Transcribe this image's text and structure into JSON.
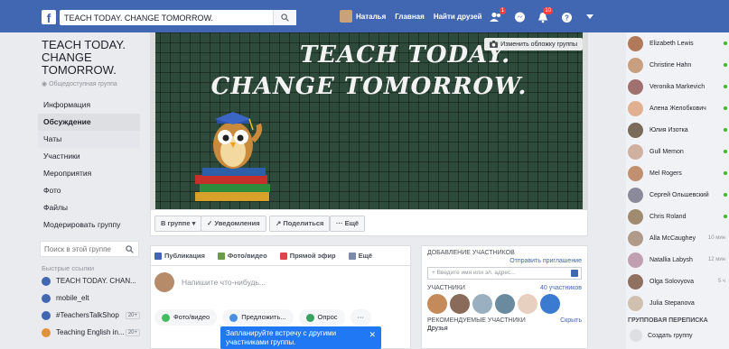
{
  "topbar": {
    "logo": "f",
    "search_value": "TEACH TODAY. CHANGE TOMORROW.",
    "user_name": "Наталья",
    "home": "Главная",
    "find_friends": "Найти друзей",
    "badge_requests": "1",
    "badge_notifications": "10"
  },
  "group": {
    "title": "TEACH TODAY. CHANGE TOMORROW.",
    "type": "Общедоступная группа"
  },
  "nav": {
    "items": [
      "Информация",
      "Обсуждение",
      "Чаты",
      "Участники",
      "Мероприятия",
      "Фото",
      "Файлы",
      "Модерировать группу"
    ]
  },
  "left_search_placeholder": "Поиск в этой группе",
  "quick_links": {
    "heading": "Быстрые ссылки",
    "items": [
      {
        "label": "TEACH TODAY. CHAN...",
        "count": ""
      },
      {
        "label": "mobile_elt",
        "count": ""
      },
      {
        "label": "#TeachersTalkShop",
        "count": "20+"
      },
      {
        "label": "Teaching English in...",
        "count": "20+"
      }
    ]
  },
  "cover": {
    "line1": "TEACH TODAY.",
    "line2": "CHANGE TOMORROW.",
    "change_cover": "Изменить обложку группы"
  },
  "actions": {
    "in_group": "В группе ▾",
    "notifications": "✓ Уведомления",
    "share": "↗ Поделиться",
    "more": "··· Ещё"
  },
  "composer": {
    "tabs": [
      "Публикация",
      "Фото/видео",
      "Прямой эфир",
      "Ещё"
    ],
    "placeholder": "Напишите что-нибудь...",
    "buttons": [
      "Фото/видео",
      "Предложить...",
      "Опрос",
      "···"
    ],
    "tooltip": "Запланируйте встречу с другими участниками группы."
  },
  "add_members": {
    "heading": "ДОБАВЛЕНИЕ УЧАСТНИКОВ",
    "invite": "Отправить приглашение",
    "input_placeholder": "+ Введите имя или эл. адрес...",
    "members_label": "УЧАСТНИКИ",
    "members_count": "40 участников",
    "recommended_label": "РЕКОМЕНДУЕМЫЕ УЧАСТНИКИ",
    "hide": "Скрыть",
    "friends": "Друзья"
  },
  "chat": {
    "friends": [
      {
        "name": "Elizabeth Lewis",
        "time": ""
      },
      {
        "name": "Christine Hahn",
        "time": ""
      },
      {
        "name": "Veronika Markevich",
        "time": ""
      },
      {
        "name": "Алена Желобкович",
        "time": ""
      },
      {
        "name": "Юлия Изотка",
        "time": ""
      },
      {
        "name": "Gull Memon",
        "time": ""
      },
      {
        "name": "Mel Rogers",
        "time": ""
      },
      {
        "name": "Сергей Ольшевский",
        "time": ""
      },
      {
        "name": "Chris Roland",
        "time": ""
      },
      {
        "name": "Alla McCaughey",
        "time": "10 мин"
      },
      {
        "name": "Natallia Labysh",
        "time": "12 мин"
      },
      {
        "name": "Olga Solovyova",
        "time": "5 ч"
      },
      {
        "name": "Julia Stepanova",
        "time": ""
      }
    ],
    "group_chats_heading": "ГРУППОВАЯ ПЕРЕПИСКА",
    "create_group": "Создать группу"
  },
  "colors": {
    "brand": "#4267b2",
    "online": "#42b72a",
    "badge": "#fa3e3e",
    "tooltip": "#2078f4"
  }
}
